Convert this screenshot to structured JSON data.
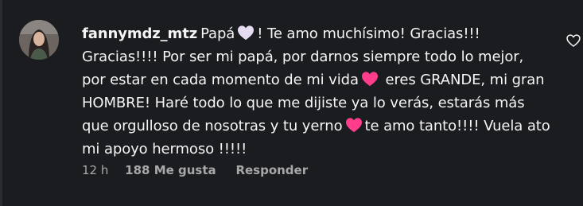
{
  "comment": {
    "username": "fannymdz_mtz",
    "segments": [
      {
        "type": "text",
        "value": "Papá"
      },
      {
        "type": "emoji",
        "name": "white-heart-icon",
        "color": "#e6dcf2"
      },
      {
        "type": "text",
        "value": "! Te amo muchísimo! Gracias!!! Gracias!!!! Por ser mi papá, por darnos siempre todo lo mejor, por estar en cada momento de mi vida"
      },
      {
        "type": "emoji",
        "name": "pink-heart-icon",
        "color": "#ff3d8b"
      },
      {
        "type": "text",
        "value": " eres GRANDE, mi gran HOMBRE! Haré todo lo que me dijiste ya lo verás, estarás más que orgulloso de nosotras y tu yerno"
      },
      {
        "type": "emoji",
        "name": "pink-heart-icon",
        "color": "#ff3d8b"
      },
      {
        "type": "text",
        "value": "te amo tanto!!!! Vuela ato mi apoyo hermoso !!!!!"
      }
    ],
    "time": "12 h",
    "likes": "188 Me gusta",
    "reply_label": "Responder"
  },
  "colors": {
    "background": "#1b1c20",
    "text": "#f5f5f5",
    "muted": "#a8a8a8"
  },
  "icons": {
    "like": "heart-outline-icon"
  }
}
